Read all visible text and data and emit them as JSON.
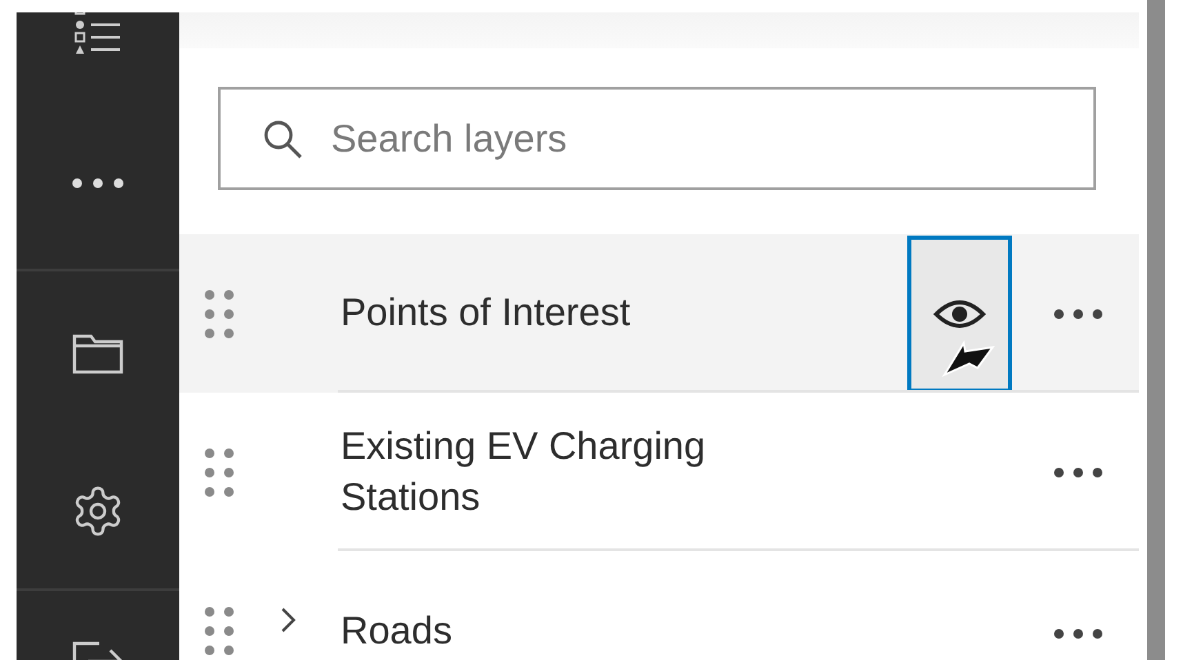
{
  "search": {
    "placeholder": "Search layers"
  },
  "layers": [
    {
      "name": "Points of Interest",
      "kind": "layer",
      "hovered": true,
      "focused": true
    },
    {
      "name": "Existing EV Charging Stations",
      "kind": "layer",
      "hovered": false,
      "focused": false
    },
    {
      "name": "Roads",
      "kind": "group",
      "hovered": false,
      "focused": false
    }
  ]
}
